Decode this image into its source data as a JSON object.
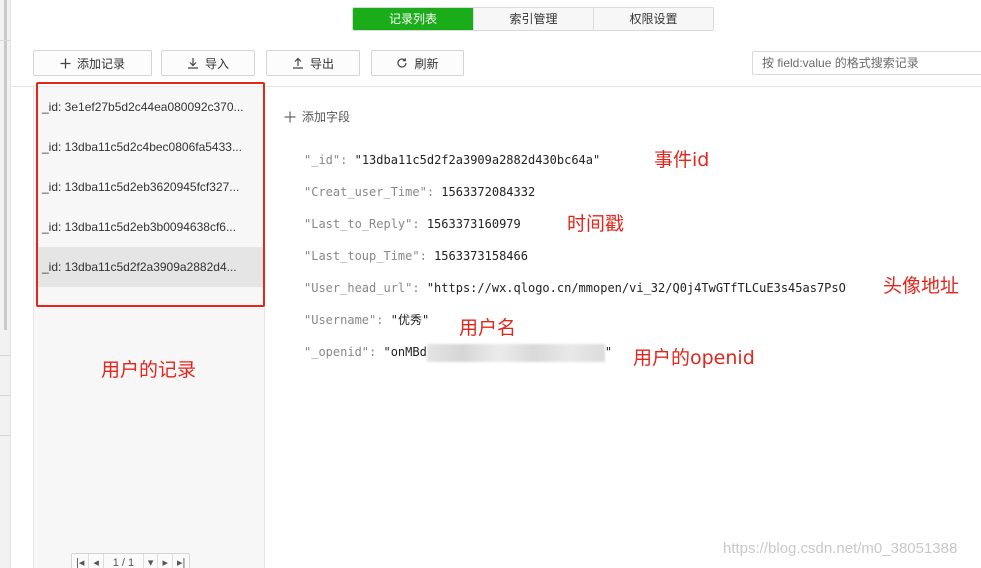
{
  "tabs": [
    {
      "label": "记录列表",
      "active": true
    },
    {
      "label": "索引管理",
      "active": false
    },
    {
      "label": "权限设置",
      "active": false
    }
  ],
  "toolbar": {
    "add_label": "添加记录",
    "import_label": "导入",
    "export_label": "导出",
    "refresh_label": "刷新"
  },
  "search": {
    "placeholder": "按 field:value 的格式搜索记录"
  },
  "records": [
    {
      "label": "_id: 3e1ef27b5d2c44ea080092c370...",
      "selected": false
    },
    {
      "label": "_id: 13dba11c5d2c4bec0806fa5433...",
      "selected": false
    },
    {
      "label": "_id: 13dba11c5d2eb3620945fcf327...",
      "selected": false
    },
    {
      "label": "_id: 13dba11c5d2eb3b0094638cf6...",
      "selected": false
    },
    {
      "label": "_id: 13dba11c5d2f2a3909a2882d4...",
      "selected": true
    }
  ],
  "pagination": {
    "page": "1 / 1"
  },
  "detail": {
    "add_field_label": "添加字段",
    "fields": [
      {
        "key": "\"_id\":",
        "value": "\"13dba11c5d2f2a3909a2882d430bc64a\""
      },
      {
        "key": "\"Creat_user_Time\":",
        "value": "1563372084332"
      },
      {
        "key": "\"Last_to_Reply\":",
        "value": "1563373160979"
      },
      {
        "key": "\"Last_toup_Time\":",
        "value": "1563373158466"
      },
      {
        "key": "\"User_head_url\":",
        "value": "\"https://wx.qlogo.cn/mmopen/vi_32/Q0j4TwGTfTLCuE3s45as7PsO"
      },
      {
        "key": "\"Username\":",
        "value": "\"优秀\""
      },
      {
        "key": "\"_openid\":",
        "value_prefix": "\"onMBd",
        "value_suffix": "\""
      }
    ]
  },
  "annotations": {
    "event_id": "事件id",
    "timestamp": "时间戳",
    "avatar_url": "头像地址",
    "username": "用户名",
    "user_openid": "用户的openid",
    "user_records": "用户的记录",
    "color": "#e3261c"
  },
  "watermark": "https://blog.csdn.net/m0_38051388",
  "colors": {
    "accent": "#1aad19",
    "selected_row": "#e5e5e5"
  },
  "icons": [
    "plus-icon",
    "download-icon",
    "upload-icon",
    "refresh-icon",
    "first-page-icon",
    "prev-page-icon",
    "next-page-icon",
    "last-page-icon"
  ]
}
